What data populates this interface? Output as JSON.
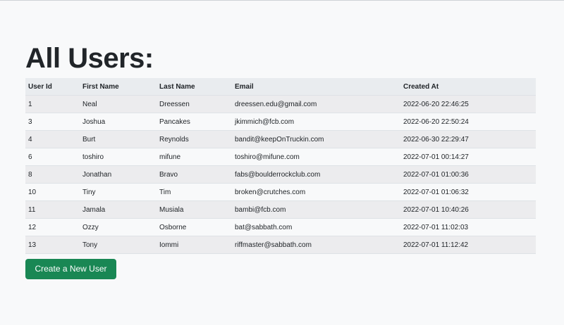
{
  "page": {
    "title": "All Users:"
  },
  "table": {
    "headers": {
      "user_id": "User Id",
      "first_name": "First Name",
      "last_name": "Last Name",
      "email": "Email",
      "created_at": "Created At"
    },
    "rows": [
      {
        "id": "1",
        "first": "Neal",
        "last": "Dreessen",
        "email": "dreessen.edu@gmail.com",
        "created": "2022-06-20 22:46:25"
      },
      {
        "id": "3",
        "first": "Joshua",
        "last": "Pancakes",
        "email": "jkimmich@fcb.com",
        "created": "2022-06-20 22:50:24"
      },
      {
        "id": "4",
        "first": "Burt",
        "last": "Reynolds",
        "email": "bandit@keepOnTruckin.com",
        "created": "2022-06-30 22:29:47"
      },
      {
        "id": "6",
        "first": "toshiro",
        "last": "mifune",
        "email": "toshiro@mifune.com",
        "created": "2022-07-01 00:14:27"
      },
      {
        "id": "8",
        "first": "Jonathan",
        "last": "Bravo",
        "email": "fabs@boulderrockclub.com",
        "created": "2022-07-01 01:00:36"
      },
      {
        "id": "10",
        "first": "Tiny",
        "last": "Tim",
        "email": "broken@crutches.com",
        "created": "2022-07-01 01:06:32"
      },
      {
        "id": "11",
        "first": "Jamala",
        "last": "Musiala",
        "email": "bambi@fcb.com",
        "created": "2022-07-01 10:40:26"
      },
      {
        "id": "12",
        "first": "Ozzy",
        "last": "Osborne",
        "email": "bat@sabbath.com",
        "created": "2022-07-01 11:02:03"
      },
      {
        "id": "13",
        "first": "Tony",
        "last": "Iommi",
        "email": "riffmaster@sabbath.com",
        "created": "2022-07-01 11:12:42"
      }
    ]
  },
  "actions": {
    "create_label": "Create a New User"
  },
  "colors": {
    "primary_button": "#198754",
    "page_background": "#f8f9fa",
    "striped_row": "#ececee"
  }
}
